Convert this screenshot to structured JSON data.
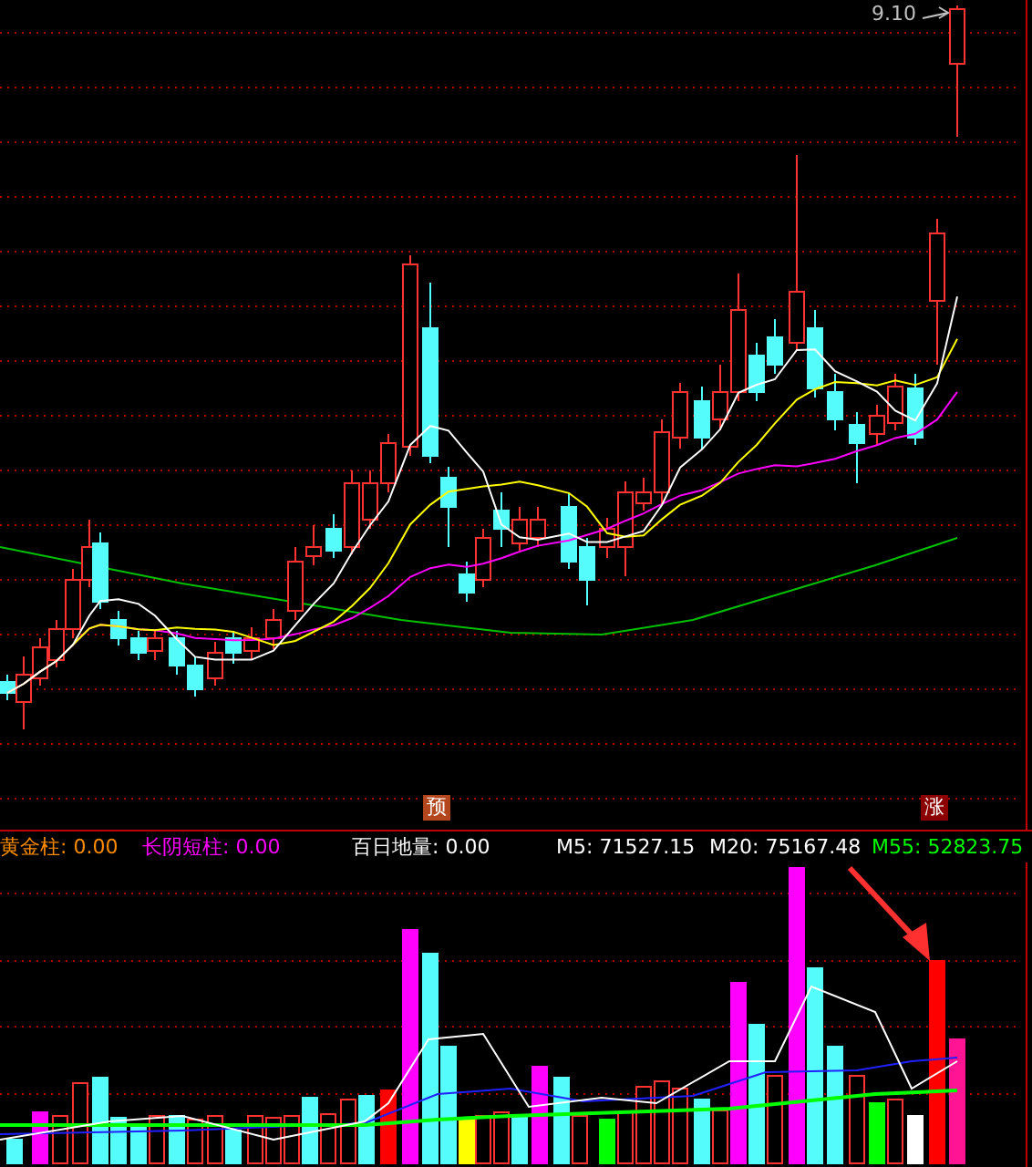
{
  "price_panel": {
    "high_label": "9.10",
    "markers": [
      {
        "text": "预",
        "kind": "forecast"
      },
      {
        "text": "涨",
        "kind": "rise"
      }
    ]
  },
  "indicator_panel": {
    "legend": [
      {
        "text": "黄金柱: 0.00",
        "color": "#ff8c00"
      },
      {
        "text": "长阴短柱: 0.00",
        "color": "#ff00ff"
      },
      {
        "text": "百日地量: 0.00",
        "color": "#ffffff"
      },
      {
        "text": "M5: 71527.15",
        "color": "#ffffff"
      },
      {
        "text": "M20: 75167.48",
        "color": "#ffffff"
      },
      {
        "text": "M55: 52823.75",
        "color": "#00ff00"
      }
    ]
  }
}
